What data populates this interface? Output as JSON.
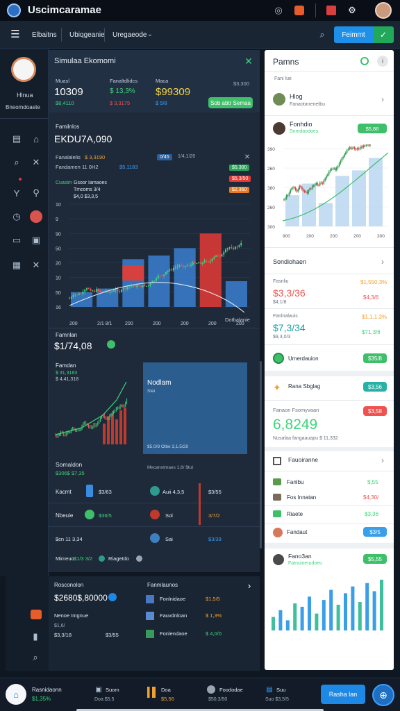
{
  "app": {
    "title": "Uscimcaramae",
    "avatar_icon": "user-avatar-icon"
  },
  "nav": {
    "dropdown1": "Elbaitns",
    "dropdown2": "Ubiqgeanie",
    "dropdown3": "Uregaeode",
    "primary_button": "Feimmt"
  },
  "profile": {
    "name": "Hlnua",
    "subtitle": "Bneomdoaete"
  },
  "summary": {
    "title": "Simulaa Ekomomi",
    "col1_label": "Muasl",
    "col1_value": "10309",
    "col1_delta": "$8,4110",
    "col2_label": "Fanaltdlidcs",
    "col2_value": "$ 13,3%",
    "col2_delta": "$ 3,3175",
    "col3_label": "Maca",
    "col3_value": "$99309",
    "col3_delta": "$ 5/8",
    "col3_extra": "$3,300",
    "button": "Sob abtr Semaa"
  },
  "main_chart": {
    "label": "Familnlos",
    "value": "EKDU7A,090",
    "sub1_label": "Fanalalelis",
    "sub1_value": "$ 3,3190",
    "sub2_label": "Fandamen 11 0H2",
    "sub2_value": "$5,1183",
    "legend1": "0/45",
    "legend2": "1/4,1/20",
    "badge1": "$5,300",
    "badge2": "$5,3/50",
    "badge3": "$2,360",
    "ann1": "Cuasim",
    "ann2": "Gsoor Iamaoes",
    "ann3": "Tmcoms 3/4",
    "ann4": "$4,0 $3,3,5",
    "y_ticks": [
      "10",
      "9",
      "90",
      "50",
      "20",
      "10",
      "50",
      "16"
    ],
    "x_ticks": [
      "200",
      "2/1 8/1",
      "200",
      "200",
      "200",
      "200",
      "200"
    ],
    "footer": "Dotbalanie"
  },
  "chart_data": [
    {
      "type": "bar",
      "title": "EKDU7A,090",
      "categories": [
        "1",
        "2",
        "3",
        "4",
        "5",
        "6",
        "7"
      ],
      "values": [
        20,
        25,
        65,
        70,
        80,
        100,
        35
      ],
      "ylim": [
        0,
        140
      ]
    },
    {
      "type": "bar",
      "title": "",
      "categories": [
        "1",
        "2",
        "3",
        "4",
        "5",
        "6"
      ],
      "values": [
        50,
        68,
        75,
        60,
        82,
        88
      ],
      "ylim": [
        0,
        100
      ]
    },
    {
      "type": "bar",
      "title": "",
      "categories": [
        "1",
        "2",
        "3",
        "4",
        "5",
        "6",
        "7",
        "8",
        "9",
        "10",
        "11",
        "12",
        "13",
        "14",
        "15",
        "16"
      ],
      "values": [
        20,
        30,
        15,
        40,
        35,
        50,
        25,
        45,
        60,
        38,
        55,
        65,
        42,
        70,
        58,
        75
      ],
      "ylim": [
        0,
        80
      ]
    }
  ],
  "sub_panel": {
    "label": "Famnlan",
    "value": "$1/74,08",
    "mini_label": "Famdan",
    "mini_sub1": "$ 31,3183",
    "mini_sub2": "$ 4,41,318",
    "right_title": "Nodlam",
    "right_sub": "Stei",
    "right_footer": "$5,0/8 Olbe 3,1,5/28",
    "footer_text": "Mecanotmaes 1,6/ $tut"
  },
  "holdings": {
    "title": "Somaldon",
    "subtitle": "$306$ $7,35",
    "rows": [
      {
        "left_label": "Kacmt",
        "left_val": "$3/63",
        "right_label": "Auii 4,3,5",
        "right_val": "$3/55"
      },
      {
        "left_label": "Nbeuie",
        "left_val": "$36/5",
        "right_label": "Sol",
        "right_val": "3/7/2"
      },
      {
        "left_label": "$cn 11 3,34",
        "left_val": "",
        "right_label": "Sai",
        "right_val": "$3/39"
      }
    ],
    "footer_label": "Mimeuo",
    "footer_val": "$1/3 3/2",
    "footer_extra": "Riagetdo"
  },
  "bottom": {
    "label": "Rosconolon",
    "value": "$2680$,80000",
    "sub_label": "Nenoe Imgnue",
    "sub_val1": "$1,6/",
    "sub_val2": "$3,3/18",
    "sub_val3": "$3/55",
    "right_title": "Fanmlaunos",
    "rows": [
      {
        "label": "Fonlnidaoe",
        "val": "$1,5/5"
      },
      {
        "label": "Fauvdnloan",
        "val": "$ 1,3%"
      },
      {
        "label": "Fonlendaoe",
        "val": "$ 4,0/0"
      }
    ]
  },
  "right": {
    "title": "Pamns",
    "sub": "Fani lue",
    "p1_name": "Hlog",
    "p1_sub": "Fanaotanenetbu",
    "p2_name": "Fonhdio",
    "p2_sub": "Snmdaodoes",
    "p2_badge": "$5,86",
    "chart_y": [
      "390",
      "260",
      "380",
      "260",
      "300"
    ],
    "chart_x": [
      "900",
      "200",
      "200",
      "200",
      "300"
    ],
    "sec2_title": "Sondiohaen",
    "stat1_label": "Fasnliu",
    "stat1_value": "$3,3/36",
    "stat1_sub": "$4,1/8",
    "stat1_right": "$1,550,3%",
    "stat1_right2": "$4,3/6",
    "stat2_label": "Fanlnalauis",
    "stat2_value": "$7,3/34",
    "stat2_sub": "$9,3,0/3",
    "stat2_right": "$1,1,1,3%",
    "stat2_right2": "$71,3/6",
    "pill_label": "Umerdauion",
    "pill_badge": "$35/8",
    "promo_label": "Rana Sbglag",
    "promo_badge": "$3,56",
    "big_label": "Fanaon Fsomyvaan",
    "big_badge": "$3,58",
    "big_value": "6,8249",
    "big_sub": "Nusafaa fangaauapu $ 11,332",
    "list_title": "Fauoiranne",
    "list_rows": [
      {
        "label": "Fanlbu",
        "val": "$,55",
        "color": "grn"
      },
      {
        "label": "Fos Innatan",
        "val": "$4,30/",
        "color": "red"
      },
      {
        "label": "Riaete",
        "val": "$3,36",
        "color": "grn"
      },
      {
        "label": "Fandaut",
        "val": "$3/5",
        "color": "badge"
      }
    ],
    "bottom_label": "Fano3an",
    "bottom_sub": "Fatnuioerudoeu",
    "bottom_badge": "$5,55"
  },
  "footer": {
    "item1_label": "Rasnidaonn",
    "item1_val": "$1,35%",
    "item2_label": "Suom",
    "item2_val": "Doa $5,5",
    "item3_label": "Doa",
    "item3_val": "$5,56",
    "item4_label": "Foododae",
    "item4_val": "$50,3/50",
    "item5_label": "Suu",
    "item5_val": "Suo $3,5/5",
    "button": "Rasha lan"
  },
  "colors": {
    "accent": "#1e88e5",
    "positive": "#3fd47a",
    "negative": "#ef5350",
    "panel": "#1e2a3a"
  }
}
